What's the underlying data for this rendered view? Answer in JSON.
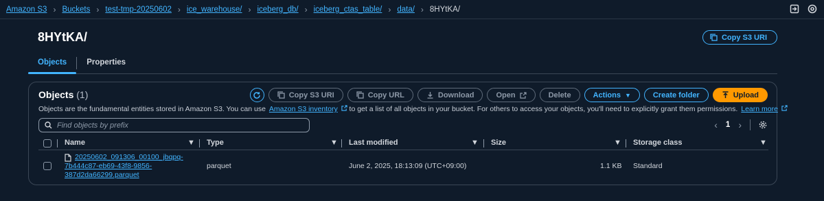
{
  "breadcrumb": {
    "items": [
      "Amazon S3",
      "Buckets",
      "test-tmp-20250602",
      "ice_warehouse/",
      "iceberg_db/",
      "iceberg_ctas_table/",
      "data/"
    ],
    "current": "8HYtKA/"
  },
  "header": {
    "title": "8HYtKA/",
    "copy_uri_label": "Copy S3 URI"
  },
  "tabs": [
    {
      "label": "Objects",
      "active": true
    },
    {
      "label": "Properties",
      "active": false
    }
  ],
  "objects_panel": {
    "title": "Objects",
    "count": "(1)",
    "actions": {
      "copy_s3_uri": "Copy S3 URI",
      "copy_url": "Copy URL",
      "download": "Download",
      "open": "Open",
      "delete": "Delete",
      "actions": "Actions",
      "create_folder": "Create folder",
      "upload": "Upload"
    },
    "description": {
      "part1": "Objects are the fundamental entities stored in Amazon S3. You can use",
      "inventory_link": "Amazon S3 inventory",
      "part2": "to get a list of all objects in your bucket. For others to access your objects, you'll need to explicitly grant them permissions.",
      "learn_more": "Learn more"
    },
    "search": {
      "placeholder": "Find objects by prefix",
      "value": ""
    },
    "pagination": {
      "page": "1"
    },
    "columns": {
      "name": "Name",
      "type": "Type",
      "last_modified": "Last modified",
      "size": "Size",
      "storage_class": "Storage class"
    },
    "rows": [
      {
        "name_line1": "20250602_091306_00100_jbqpq-",
        "name_line2": "7b444c87-eb69-43f8-9856-",
        "name_line3": "387d2da66299.parquet",
        "type": "parquet",
        "last_modified": "June 2, 2025, 18:13:09 (UTC+09:00)",
        "size": "1.1 KB",
        "storage_class": "Standard"
      }
    ]
  },
  "colors": {
    "background": "#0f1b2a",
    "link": "#42b4ff",
    "accent_orange": "#ff9900",
    "border": "#3b4756"
  }
}
